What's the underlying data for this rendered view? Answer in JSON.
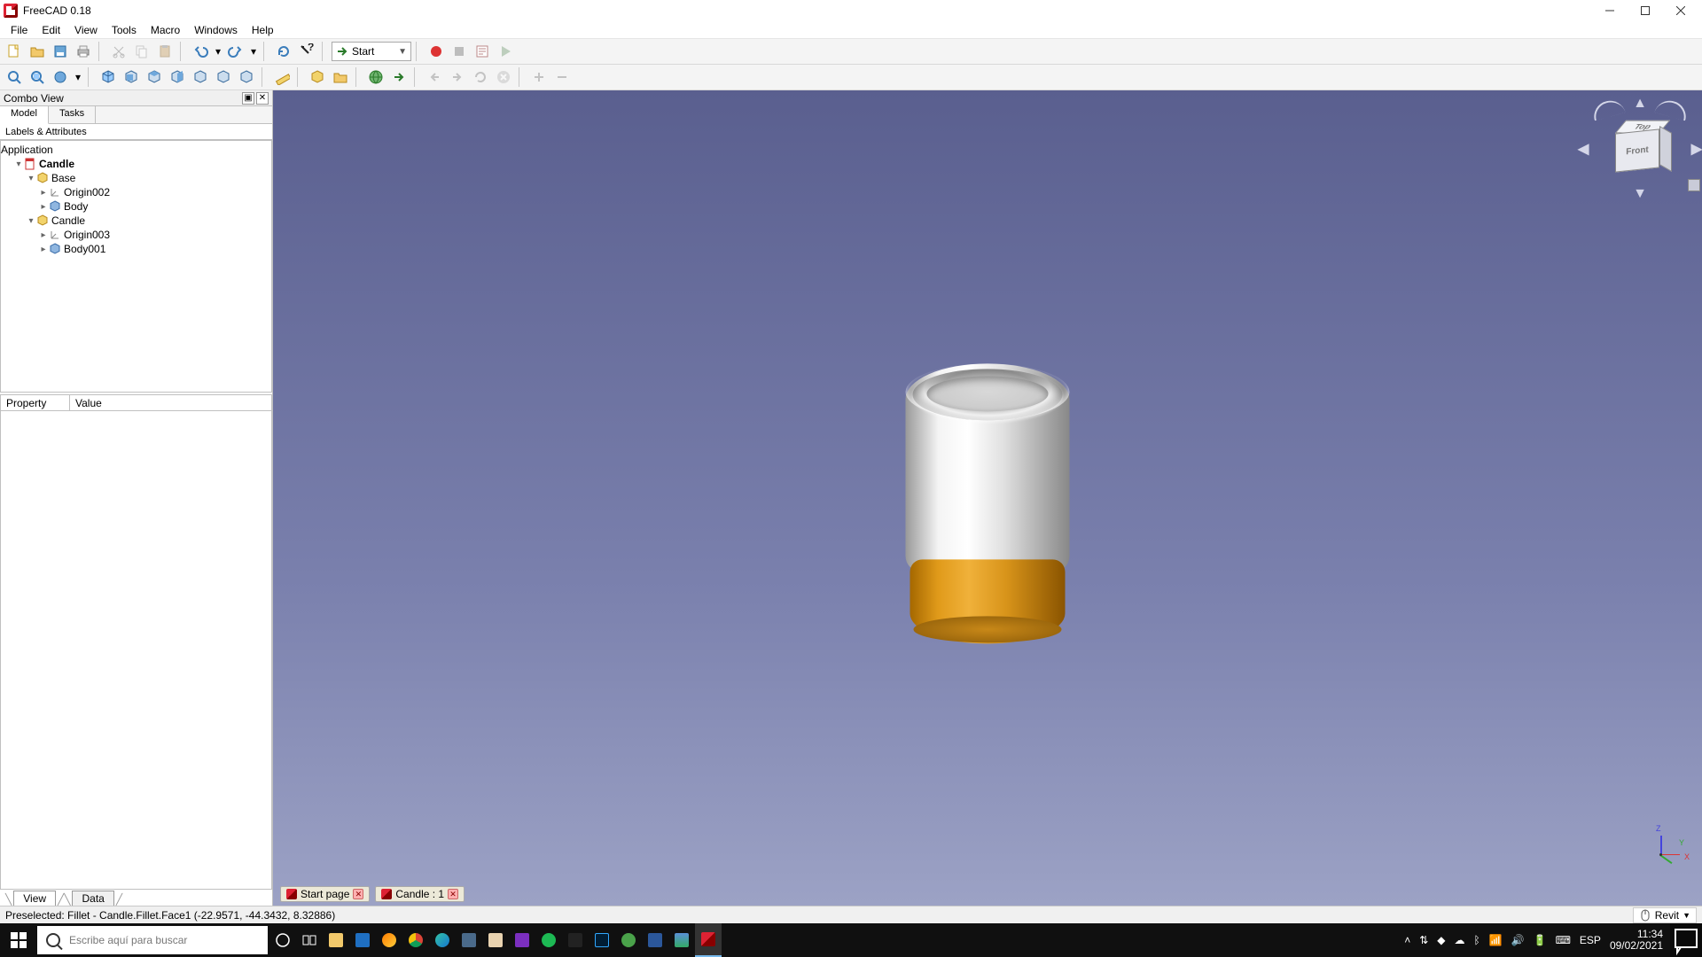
{
  "app": {
    "title": "FreeCAD 0.18"
  },
  "menu": [
    "File",
    "Edit",
    "View",
    "Tools",
    "Macro",
    "Windows",
    "Help"
  ],
  "workbench": {
    "label": "Start"
  },
  "combo": {
    "title": "Combo View",
    "tabs": [
      "Model",
      "Tasks"
    ],
    "active_tab": "Model",
    "labels_header": "Labels & Attributes",
    "root": "Application",
    "tree": [
      {
        "label": "Candle",
        "bold": true,
        "depth": 0,
        "icon": "doc",
        "expand": "▾"
      },
      {
        "label": "Base",
        "depth": 1,
        "icon": "part",
        "expand": "▾"
      },
      {
        "label": "Origin002",
        "depth": 2,
        "icon": "origin",
        "expand": "▸"
      },
      {
        "label": "Body",
        "depth": 2,
        "icon": "body",
        "expand": "▸"
      },
      {
        "label": "Candle",
        "depth": 1,
        "icon": "part",
        "expand": "▾"
      },
      {
        "label": "Origin003",
        "depth": 2,
        "icon": "origin",
        "expand": "▸"
      },
      {
        "label": "Body001",
        "depth": 2,
        "icon": "body",
        "expand": "▸"
      }
    ],
    "property_cols": [
      "Property",
      "Value"
    ],
    "bottom_tabs": [
      "View",
      "Data"
    ],
    "bottom_active": "View"
  },
  "viewport": {
    "cube_face": "Front",
    "cube_top_face": "Top",
    "axes": {
      "x": "X",
      "y": "Y",
      "z": "Z"
    }
  },
  "doc_tabs": [
    {
      "label": "Start page",
      "closable": true
    },
    {
      "label": "Candle : 1",
      "closable": true
    }
  ],
  "status": {
    "text": "Preselected: Fillet - Candle.Fillet.Face1 (-22.9571, -44.3432, 8.32886)",
    "nav_style": "Revit"
  },
  "taskbar": {
    "search_placeholder": "Escribe aquí para buscar",
    "lang": "ESP",
    "time": "11:34",
    "date": "09/02/2021"
  }
}
